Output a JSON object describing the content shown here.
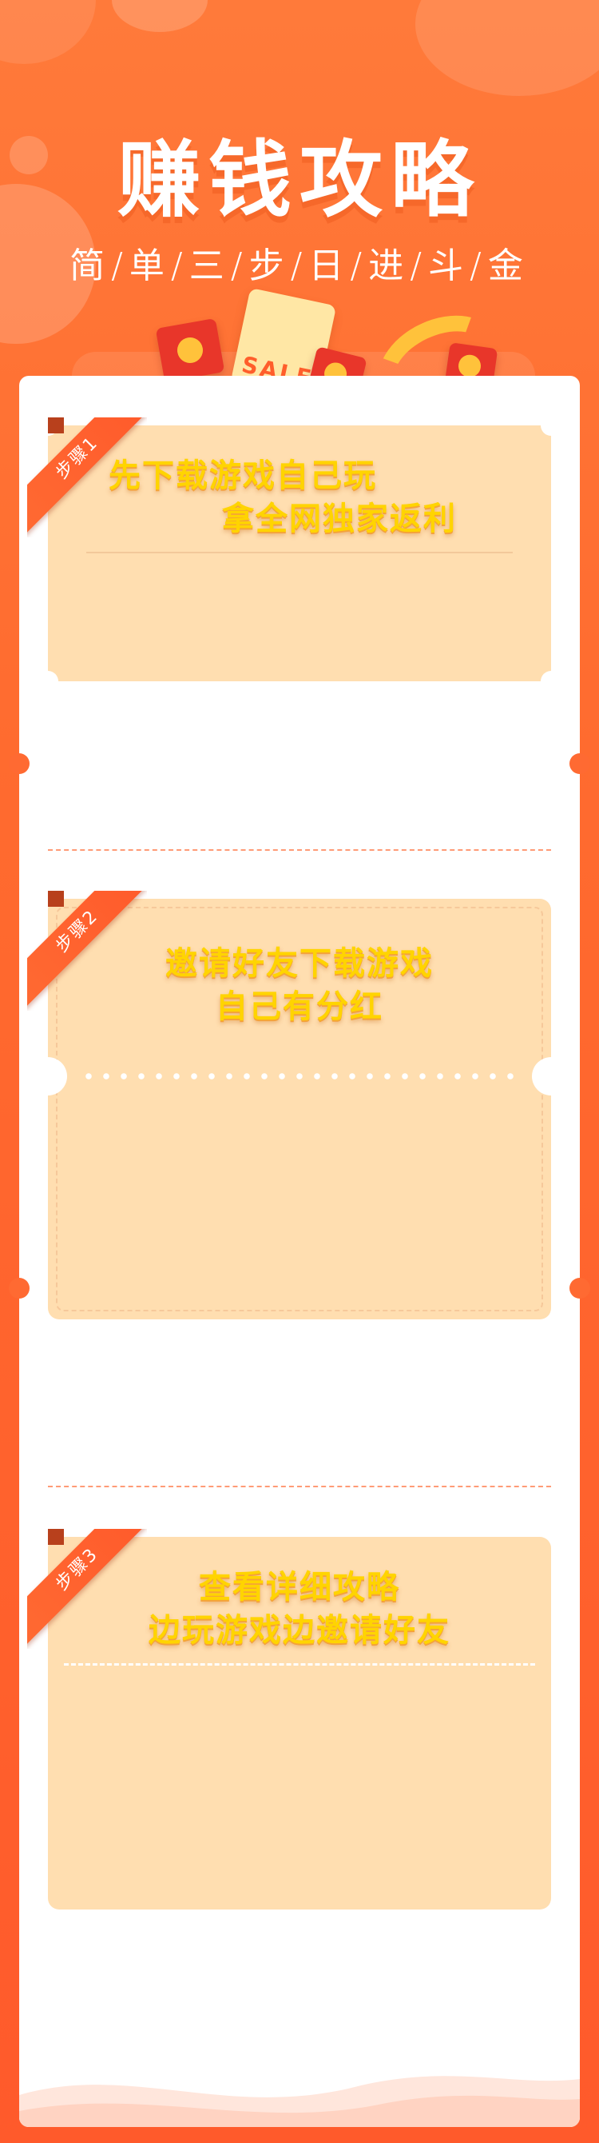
{
  "header": {
    "title": "赚钱攻略",
    "subtitle": "简/单/三/步/日/进/斗/金",
    "sale_text": "SALE"
  },
  "steps": [
    {
      "badge": "步骤1",
      "line1": "先下载游戏自己玩",
      "line2": "拿全网独家返利"
    },
    {
      "badge": "步骤2",
      "line1": "邀请好友下载游戏",
      "line2": "自己有分红"
    },
    {
      "badge": "步骤3",
      "line1": "查看详细攻略",
      "line2": "边玩游戏边邀请好友"
    }
  ],
  "colors": {
    "background": "#ff6b2f",
    "card": "#ffdeb0",
    "accent_yellow": "#ffd400",
    "ribbon": "#ff5a2b"
  }
}
